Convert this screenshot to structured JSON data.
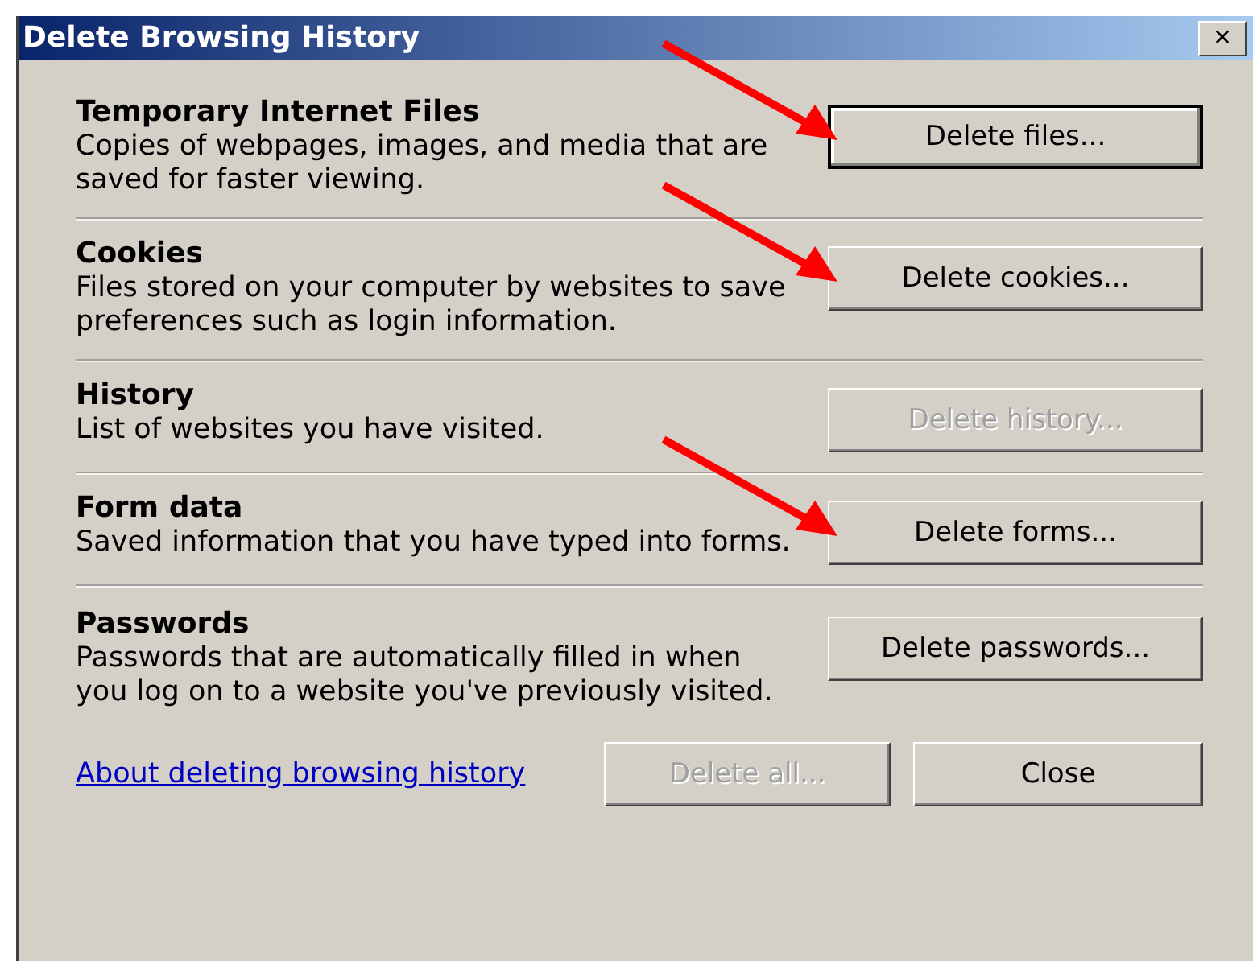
{
  "window": {
    "title": "Delete Browsing History",
    "close": "✕"
  },
  "sections": [
    {
      "title": "Temporary Internet Files",
      "description": "Copies of webpages, images, and media that are saved for faster viewing.",
      "button": "Delete files...",
      "disabled": false,
      "default": true,
      "arrow": true
    },
    {
      "title": "Cookies",
      "description": "Files stored on your computer by websites to save preferences such as login information.",
      "button": "Delete cookies...",
      "disabled": false,
      "default": false,
      "arrow": true
    },
    {
      "title": "History",
      "description": "List of websites you have visited.",
      "button": "Delete history...",
      "disabled": true,
      "default": false,
      "arrow": false
    },
    {
      "title": "Form data",
      "description": "Saved information that you have typed into forms.",
      "button": "Delete forms...",
      "disabled": false,
      "default": false,
      "arrow": true
    },
    {
      "title": "Passwords",
      "description": "Passwords that are automatically filled in when you log on to a website you've previously visited.",
      "button": "Delete passwords...",
      "disabled": false,
      "default": false,
      "arrow": false
    }
  ],
  "footer": {
    "link": "About deleting browsing history",
    "buttons": [
      {
        "label": "Delete all...",
        "disabled": true
      },
      {
        "label": "Close",
        "disabled": false
      }
    ]
  }
}
